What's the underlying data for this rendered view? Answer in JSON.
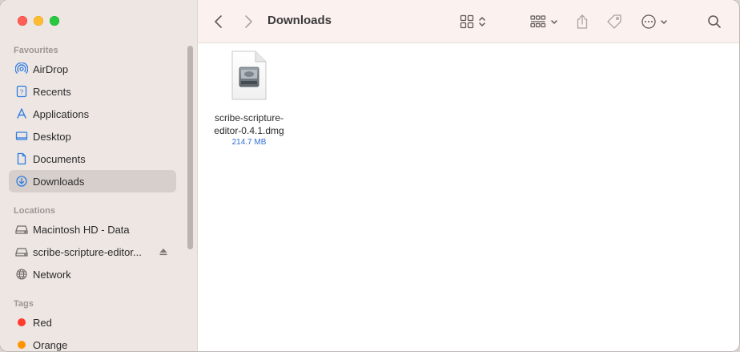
{
  "window": {
    "title": "Downloads"
  },
  "sidebar": {
    "favourites_title": "Favourites",
    "favourites": [
      {
        "label": "AirDrop",
        "icon": "airdrop-icon"
      },
      {
        "label": "Recents",
        "icon": "recents-icon"
      },
      {
        "label": "Applications",
        "icon": "applications-icon"
      },
      {
        "label": "Desktop",
        "icon": "desktop-icon"
      },
      {
        "label": "Documents",
        "icon": "documents-icon"
      },
      {
        "label": "Downloads",
        "icon": "downloads-icon",
        "selected": true
      }
    ],
    "locations_title": "Locations",
    "locations": [
      {
        "label": "Macintosh HD - Data",
        "icon": "drive-icon"
      },
      {
        "label": "scribe-scripture-editor...",
        "icon": "drive-icon",
        "ejectable": true
      },
      {
        "label": "Network",
        "icon": "network-icon"
      }
    ],
    "tags_title": "Tags",
    "tags": [
      {
        "label": "Red",
        "color": "#ff3b30"
      },
      {
        "label": "Orange",
        "color": "#ff9500"
      }
    ]
  },
  "files": [
    {
      "name": "scribe-scripture-editor-0.4.1.dmg",
      "size": "214.7 MB",
      "icon": "disk-image-icon"
    }
  ],
  "colors": {
    "accent": "#2f6fd0",
    "sidebar_bg": "#ede6e3",
    "toolbar_bg": "#fbf1ef"
  }
}
